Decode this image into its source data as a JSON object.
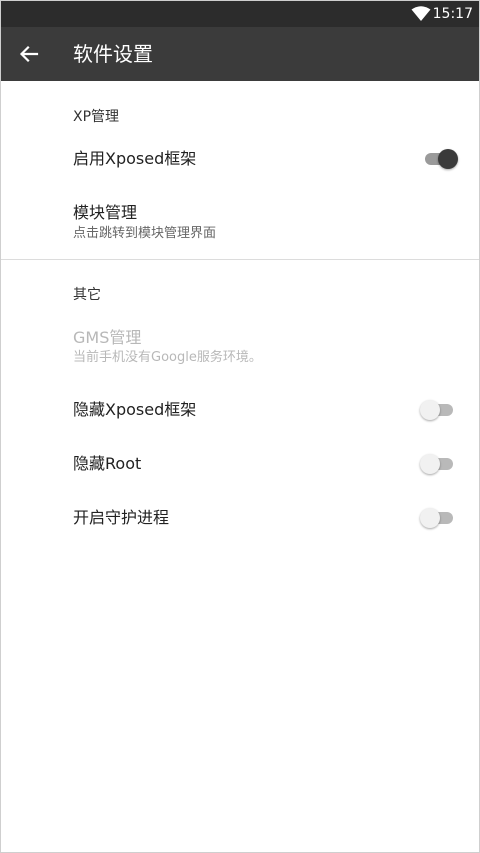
{
  "statusbar": {
    "time": "15:17",
    "icons": [
      "wifi-icon"
    ]
  },
  "appbar": {
    "back_icon": "arrow-left-icon",
    "title": "软件设置"
  },
  "sections": {
    "xp": {
      "header": "XP管理",
      "enable_xposed": {
        "title": "启用Xposed框架",
        "checked": true
      },
      "module_manage": {
        "title": "模块管理",
        "summary": "点击跳转到模块管理界面"
      }
    },
    "other": {
      "header": "其它",
      "gms": {
        "title": "GMS管理",
        "summary": "当前手机没有Google服务环境。",
        "enabled": false
      },
      "hide_xposed": {
        "title": "隐藏Xposed框架",
        "checked": false
      },
      "hide_root": {
        "title": "隐藏Root",
        "checked": false
      },
      "daemon": {
        "title": "开启守护进程",
        "checked": false
      }
    }
  },
  "colors": {
    "statusbar": "#2c2c2c",
    "appbar": "#3b3b3b",
    "switch_on_thumb": "#3a3a3a",
    "switch_off_thumb": "#f1f1f1"
  }
}
